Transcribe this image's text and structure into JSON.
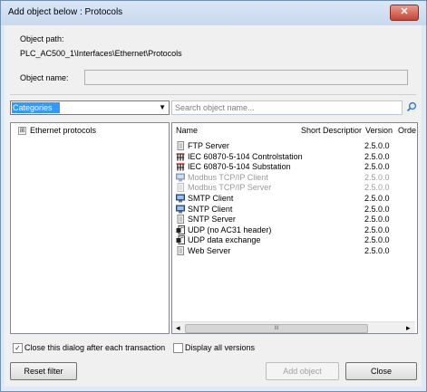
{
  "window": {
    "title": "Add object below : Protocols",
    "close_glyph": "✕"
  },
  "object_path": {
    "label": "Object path:",
    "value": "PLC_AC500_1\\Interfaces\\Ethernet\\Protocols"
  },
  "object_name": {
    "label": "Object name:",
    "value": ""
  },
  "categories": {
    "selected": "Categories",
    "arrow": "▼"
  },
  "search": {
    "placeholder": "Search object name..."
  },
  "tree": {
    "items": [
      {
        "expander": "⊞",
        "label": "Ethernet protocols"
      }
    ]
  },
  "table": {
    "columns": [
      "Name",
      "Short Description",
      "Version",
      "Orde"
    ],
    "rows": [
      {
        "icon": "document-icon",
        "name": "FTP Server",
        "version": "2.5.0.0",
        "disabled": false
      },
      {
        "icon": "network-tree-icon",
        "name": "IEC 60870-5-104 Controlstation",
        "version": "2.5.0.0",
        "disabled": false
      },
      {
        "icon": "network-tree-icon",
        "name": "IEC 60870-5-104 Substation",
        "version": "2.5.0.0",
        "disabled": false
      },
      {
        "icon": "monitor-icon",
        "name": "Modbus TCP/IP Client",
        "version": "2.5.0.0",
        "disabled": true
      },
      {
        "icon": "document-icon",
        "name": "Modbus TCP/IP Server",
        "version": "2.5.0.0",
        "disabled": true
      },
      {
        "icon": "monitor-icon",
        "name": "SMTP Client",
        "version": "2.5.0.0",
        "disabled": false
      },
      {
        "icon": "monitor-icon",
        "name": "SNTP Client",
        "version": "2.5.0.0",
        "disabled": false
      },
      {
        "icon": "document-icon",
        "name": "SNTP Server",
        "version": "2.5.0.0",
        "disabled": false
      },
      {
        "icon": "udp-icon",
        "name": "UDP (no AC31 header)",
        "version": "2.5.0.0",
        "disabled": false
      },
      {
        "icon": "udp-icon",
        "name": "UDP data exchange",
        "version": "2.5.0.0",
        "disabled": false
      },
      {
        "icon": "document-icon",
        "name": "Web Server",
        "version": "2.5.0.0",
        "disabled": false
      }
    ]
  },
  "scrollbar": {
    "left": "◂",
    "thumb": "III",
    "right": "▸"
  },
  "options": {
    "close_after": {
      "label": "Close this dialog after each transaction",
      "checked": true,
      "mark": "✓"
    },
    "display_all": {
      "label": "Display all versions",
      "checked": false
    }
  },
  "buttons": {
    "reset": "Reset filter",
    "add": "Add object",
    "close": "Close"
  },
  "colors": {
    "selection": "#3399ff",
    "frame": "#6f8fb5",
    "close_red": "#c74534",
    "icon_red": "#cc2a1b"
  }
}
